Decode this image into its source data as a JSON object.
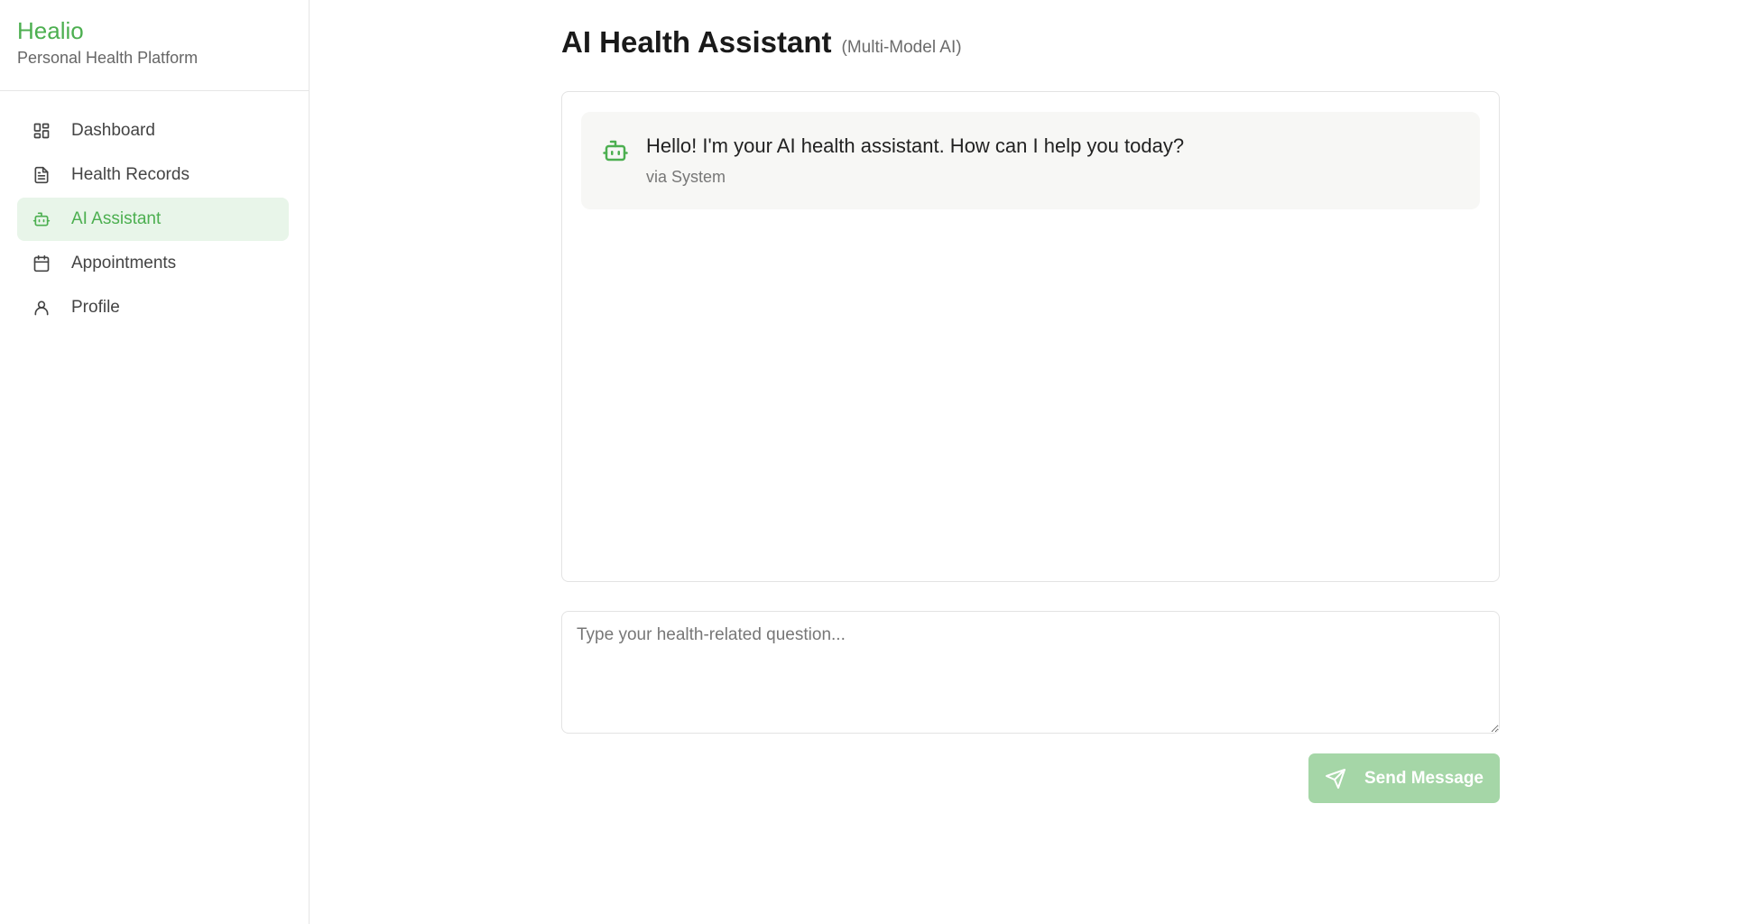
{
  "brand": {
    "name": "Healio",
    "tagline": "Personal Health Platform",
    "accent_color": "#4caf50"
  },
  "sidebar": {
    "items": [
      {
        "label": "Dashboard",
        "icon": "dashboard-grid-icon",
        "active": false
      },
      {
        "label": "Health Records",
        "icon": "document-icon",
        "active": false
      },
      {
        "label": "AI Assistant",
        "icon": "robot-icon",
        "active": true
      },
      {
        "label": "Appointments",
        "icon": "calendar-icon",
        "active": false
      },
      {
        "label": "Profile",
        "icon": "user-icon",
        "active": false
      }
    ]
  },
  "main": {
    "title": "AI Health Assistant",
    "subtitle": "(Multi-Model AI)",
    "messages": [
      {
        "text": "Hello! I'm your AI health assistant. How can I help you today?",
        "meta": "via System",
        "icon": "robot-icon"
      }
    ],
    "input": {
      "placeholder": "Type your health-related question...",
      "value": ""
    },
    "send_button": {
      "label": "Send Message",
      "icon": "send-icon",
      "color": "#a5d6a7"
    }
  }
}
